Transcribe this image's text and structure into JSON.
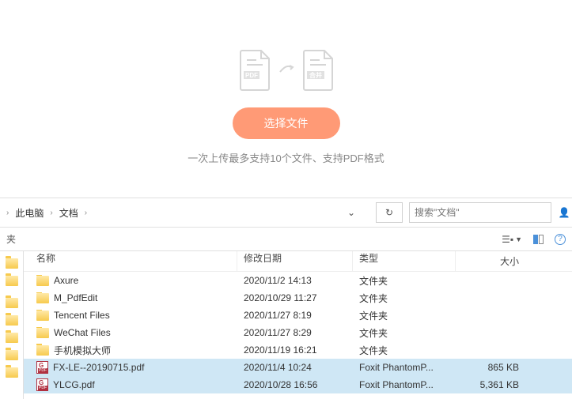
{
  "upload": {
    "pdf_badge": "PDF",
    "merge_badge": "合并",
    "button_label": "选择文件",
    "hint": "一次上传最多支持10个文件、支持PDF格式"
  },
  "toolbar": {
    "crumbs": [
      "此电脑",
      "文档"
    ],
    "search_placeholder": "搜索\"文档\""
  },
  "subbar": {
    "label": "夹"
  },
  "columns": {
    "name": "名称",
    "date": "修改日期",
    "type": "类型",
    "size": "大小"
  },
  "rows": [
    {
      "icon": "folder",
      "name": "Axure",
      "date": "2020/11/2 14:13",
      "type": "文件夹",
      "size": "",
      "selected": false
    },
    {
      "icon": "folder",
      "name": "M_PdfEdit",
      "date": "2020/10/29 11:27",
      "type": "文件夹",
      "size": "",
      "selected": false
    },
    {
      "icon": "folder",
      "name": "Tencent Files",
      "date": "2020/11/27 8:19",
      "type": "文件夹",
      "size": "",
      "selected": false
    },
    {
      "icon": "folder",
      "name": "WeChat Files",
      "date": "2020/11/27 8:29",
      "type": "文件夹",
      "size": "",
      "selected": false
    },
    {
      "icon": "folder",
      "name": "手机模拟大师",
      "date": "2020/11/19 16:21",
      "type": "文件夹",
      "size": "",
      "selected": false
    },
    {
      "icon": "pdf",
      "name": "FX-LE--20190715.pdf",
      "date": "2020/11/4 10:24",
      "type": "Foxit PhantomP...",
      "size": "865 KB",
      "selected": true
    },
    {
      "icon": "pdf",
      "name": "YLCG.pdf",
      "date": "2020/10/28 16:56",
      "type": "Foxit PhantomP...",
      "size": "5,361 KB",
      "selected": true
    }
  ]
}
